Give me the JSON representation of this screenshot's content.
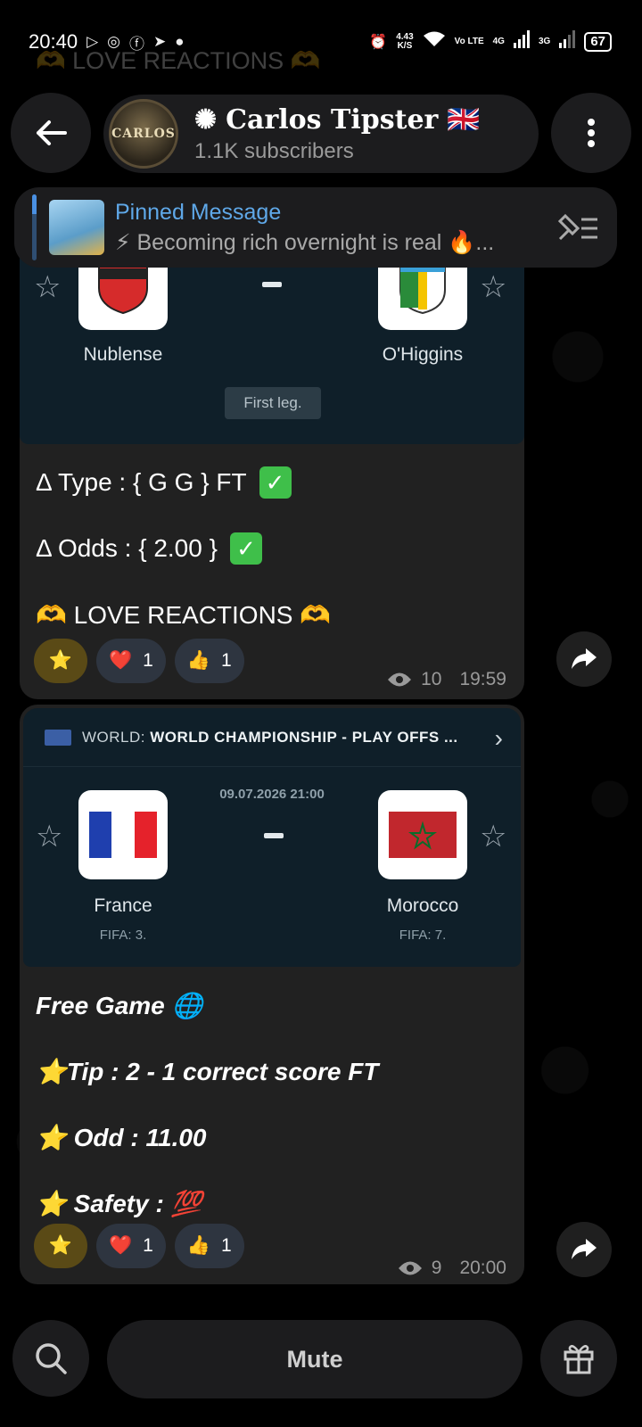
{
  "status_bar": {
    "time": "20:40",
    "net_speed_value": "4.43",
    "net_speed_unit": "K/S",
    "volte": "Vo LTE",
    "signal1": "4G",
    "signal2": "3G",
    "battery": "67"
  },
  "faded_top_text": "🫶 LOVE REACTIONS 🫶",
  "header": {
    "avatar_text": "CARLOS",
    "title": "Carlos Tipster",
    "title_emoji": "🇬🇧",
    "subscribers": "1.1K subscribers"
  },
  "pinned": {
    "title": "Pinned Message",
    "text": "⚡ Becoming rich overnight is real 🔥..."
  },
  "message1": {
    "home_team": "Nublense",
    "away_team": "O'Higgins",
    "leg": "First leg.",
    "lines": [
      "Δ Type  : { G G } FT",
      "Δ Odds : { 2.00 }",
      "🫶 LOVE REACTIONS 🫶"
    ],
    "reactions": [
      {
        "emoji": "⭐",
        "count": ""
      },
      {
        "emoji": "❤️",
        "count": "1"
      },
      {
        "emoji": "👍",
        "count": "1"
      }
    ],
    "views": "10",
    "time": "19:59"
  },
  "message2": {
    "competition_prefix": "WORLD: ",
    "competition": "WORLD CHAMPIONSHIP - PLAY OFFS ...",
    "date": "09.07.2026 21:00",
    "home_team": "France",
    "home_rank": "FIFA: 3.",
    "away_team": "Morocco",
    "away_rank": "FIFA: 7.",
    "lines": [
      "Free Game  🌐",
      "⭐Tip : 2 - 1 correct score FT",
      "⭐ Odd : 11.00",
      "⭐ Safety : 💯"
    ],
    "reactions": [
      {
        "emoji": "⭐",
        "count": ""
      },
      {
        "emoji": "❤️",
        "count": "1"
      },
      {
        "emoji": "👍",
        "count": "1"
      }
    ],
    "views": "9",
    "time": "20:00"
  },
  "bottom": {
    "mute_label": "Mute"
  }
}
